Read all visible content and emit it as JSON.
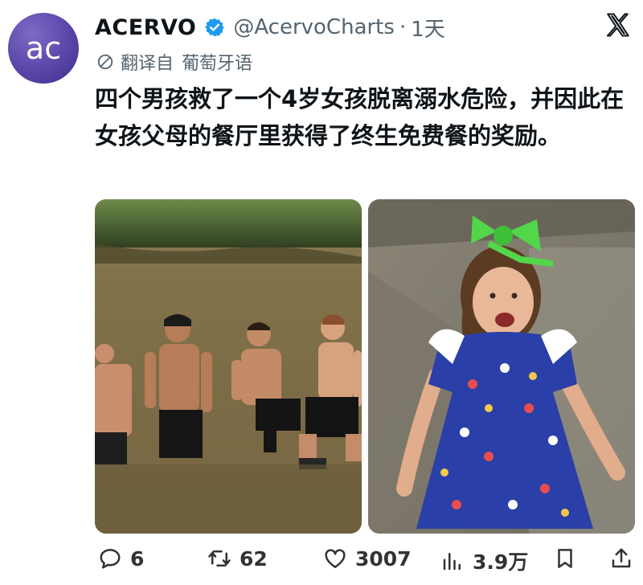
{
  "account": {
    "name": "ACERVO",
    "handle": "@AcervoCharts",
    "separator": "·",
    "time": "1天",
    "avatar_text": "ac"
  },
  "translation": {
    "label": "翻译自",
    "language": "葡萄牙语"
  },
  "tweet": {
    "text": "四个男孩救了一个4岁女孩脱离溺水危险，并因此在女孩父母的餐厅里获得了终生免费餐的奖励。"
  },
  "actions": {
    "replies": "6",
    "retweets": "62",
    "likes": "3007",
    "views": "3.9万"
  },
  "colors": {
    "verified": "#1d9bf0",
    "avatar": "#5a45a8",
    "muted": "#536471"
  },
  "icons": [
    "verified-badge-icon",
    "x-logo-icon",
    "translate-icon",
    "reply-icon",
    "retweet-icon",
    "like-icon",
    "views-icon",
    "bookmark-icon",
    "share-icon"
  ]
}
